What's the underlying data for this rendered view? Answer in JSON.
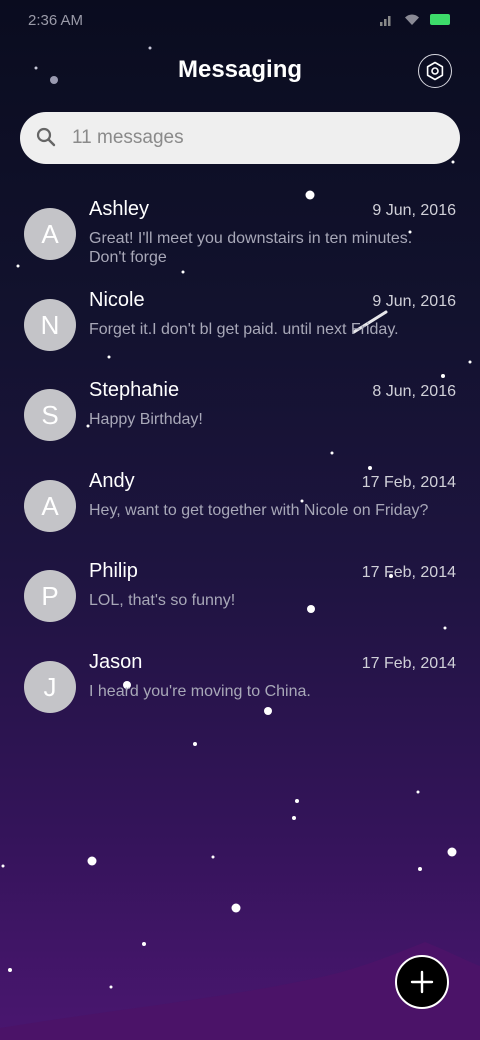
{
  "status_bar": {
    "time": "2:36 AM"
  },
  "header": {
    "title": "Messaging",
    "settings_icon": "gear-icon"
  },
  "search": {
    "text": "11 messages",
    "icon": "search-icon"
  },
  "conversations": [
    {
      "initial": "A",
      "name": "Ashley",
      "date": "9 Jun, 2016",
      "preview": "Great! I'll meet you downstairs in ten minutes. Don't forge"
    },
    {
      "initial": "N",
      "name": "Nicole",
      "date": "9 Jun, 2016",
      "preview": "Forget it.I don't bl get paid. until next Friday."
    },
    {
      "initial": "S",
      "name": "Stephanie",
      "date": "8 Jun, 2016",
      "preview": "Happy Birthday!"
    },
    {
      "initial": "A",
      "name": "Andy",
      "date": "17 Feb, 2014",
      "preview": "Hey, want to get together with Nicole on Friday?"
    },
    {
      "initial": "P",
      "name": "Philip",
      "date": "17 Feb, 2014",
      "preview": "LOL, that's so funny!"
    },
    {
      "initial": "J",
      "name": "Jason",
      "date": "17 Feb, 2014",
      "preview": "I heard you're moving to China."
    }
  ],
  "fab": {
    "icon": "plus-icon"
  },
  "colors": {
    "avatar": "#c4c4c8",
    "battery": "#3ddc6a",
    "search_bg": "#efefef"
  }
}
